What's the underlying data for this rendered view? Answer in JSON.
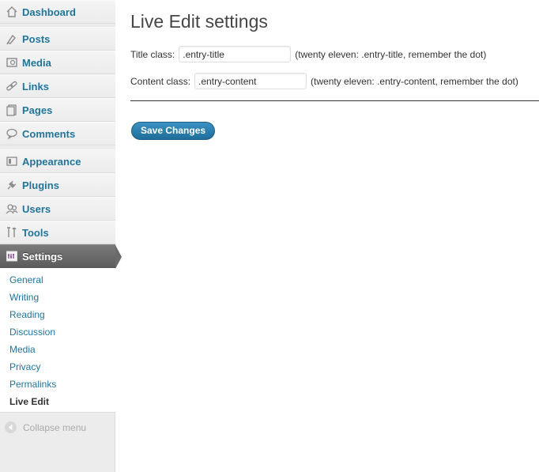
{
  "sidebar": {
    "items": [
      {
        "label": "Dashboard",
        "icon": "dashboard-icon"
      },
      {
        "label": "Posts",
        "icon": "posts-icon"
      },
      {
        "label": "Media",
        "icon": "media-icon"
      },
      {
        "label": "Links",
        "icon": "links-icon"
      },
      {
        "label": "Pages",
        "icon": "pages-icon"
      },
      {
        "label": "Comments",
        "icon": "comments-icon"
      },
      {
        "label": "Appearance",
        "icon": "appearance-icon"
      },
      {
        "label": "Plugins",
        "icon": "plugins-icon"
      },
      {
        "label": "Users",
        "icon": "users-icon"
      },
      {
        "label": "Tools",
        "icon": "tools-icon"
      },
      {
        "label": "Settings",
        "icon": "settings-icon",
        "current": true
      }
    ],
    "submenu": [
      "General",
      "Writing",
      "Reading",
      "Discussion",
      "Media",
      "Privacy",
      "Permalinks",
      "Live Edit"
    ],
    "submenu_active": "Live Edit",
    "collapse_label": "Collapse menu"
  },
  "main": {
    "title": "Live Edit settings",
    "title_class": {
      "label": "Title class:",
      "value": ".entry-title",
      "hint": "(twenty eleven: .entry-title, remember the dot)"
    },
    "content_class": {
      "label": "Content class:",
      "value": ".entry-content",
      "hint": "(twenty eleven: .entry-content, remember the dot)"
    },
    "save_label": "Save Changes"
  },
  "colors": {
    "link": "#21759b",
    "current_menu": "#6a6a6a",
    "button": "#2a7fb0"
  }
}
